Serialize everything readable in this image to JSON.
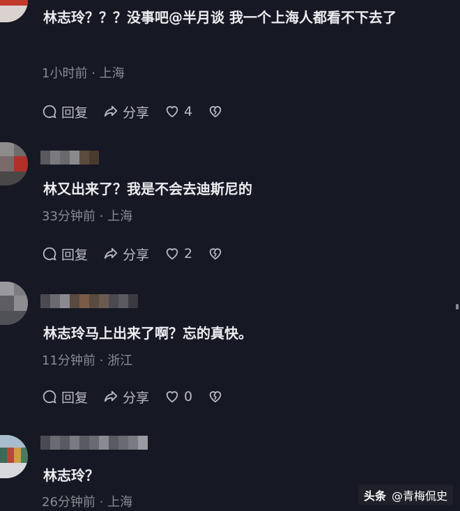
{
  "comments": [
    {
      "text": "林志玲？？？没事吧@半月谈 我一个上海人都看不下去了",
      "time": "1小时前",
      "location": "上海",
      "reply_label": "回复",
      "share_label": "分享",
      "likes": "4"
    },
    {
      "text": "林又出来了？我是不会去迪斯尼的",
      "time": "33分钟前",
      "location": "上海",
      "reply_label": "回复",
      "share_label": "分享",
      "likes": "2"
    },
    {
      "text": "林志玲马上出来了啊？忘的真快。",
      "time": "11分钟前",
      "location": "浙江",
      "reply_label": "回复",
      "share_label": "分享",
      "likes": "0"
    },
    {
      "text": "林志玲？",
      "time": "26分钟前",
      "location": "上海"
    }
  ],
  "meta_separator": "·",
  "watermark": {
    "brand": "头条",
    "account": "@青梅侃史"
  },
  "colors": {
    "background": "#161823",
    "text": "#ececf0",
    "meta": "#8a8b93",
    "action": "#b9bac2"
  },
  "icons": [
    "comment-icon",
    "share-icon",
    "heart-icon",
    "broken-heart-icon"
  ]
}
